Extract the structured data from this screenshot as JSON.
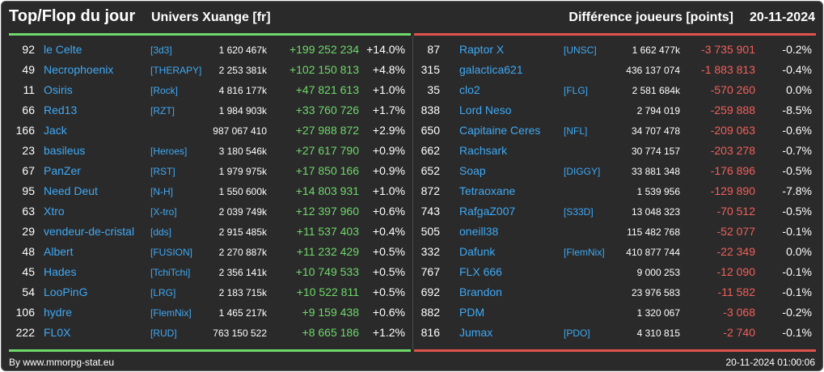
{
  "header": {
    "title": "Top/Flop du jour",
    "subtitle": "Univers Xuange [fr]",
    "metric": "Différence joueurs [points]",
    "date": "20-11-2024"
  },
  "colors": {
    "background": "#2a2a2a",
    "name": "#3fa9f5",
    "gain": "#6fd86a",
    "loss": "#f0605a"
  },
  "top": [
    {
      "rank": "92",
      "name": "le Celte",
      "alliance": "[3d3]",
      "points": "1 620 467k",
      "diff": "+199 252 234",
      "pct": "+14.0%"
    },
    {
      "rank": "49",
      "name": "Necrophoenix",
      "alliance": "[THERAPY]",
      "points": "2 253 381k",
      "diff": "+102 150 813",
      "pct": "+4.8%"
    },
    {
      "rank": "11",
      "name": "Osiris",
      "alliance": "[Rock]",
      "points": "4 816 177k",
      "diff": "+47 821 613",
      "pct": "+1.0%"
    },
    {
      "rank": "66",
      "name": "Red13",
      "alliance": "[RZT]",
      "points": "1 984 903k",
      "diff": "+33 760 726",
      "pct": "+1.7%"
    },
    {
      "rank": "166",
      "name": "Jack",
      "alliance": "",
      "points": "987 067 410",
      "diff": "+27 988 872",
      "pct": "+2.9%"
    },
    {
      "rank": "23",
      "name": "basileus",
      "alliance": "[Heroes]",
      "points": "3 180 546k",
      "diff": "+27 617 790",
      "pct": "+0.9%"
    },
    {
      "rank": "67",
      "name": "PanZer",
      "alliance": "[RST]",
      "points": "1 979 975k",
      "diff": "+17 850 166",
      "pct": "+0.9%"
    },
    {
      "rank": "95",
      "name": "Need Deut",
      "alliance": "[N-H]",
      "points": "1 550 600k",
      "diff": "+14 803 931",
      "pct": "+1.0%"
    },
    {
      "rank": "63",
      "name": "Xtro",
      "alliance": "[X-tro]",
      "points": "2 039 749k",
      "diff": "+12 397 960",
      "pct": "+0.6%"
    },
    {
      "rank": "29",
      "name": "vendeur-de-cristal",
      "alliance": "[dds]",
      "points": "2 915 485k",
      "diff": "+11 537 403",
      "pct": "+0.4%"
    },
    {
      "rank": "48",
      "name": "Albert",
      "alliance": "[FUSION]",
      "points": "2 270 887k",
      "diff": "+11 232 429",
      "pct": "+0.5%"
    },
    {
      "rank": "45",
      "name": "Hades",
      "alliance": "[TchiTchi]",
      "points": "2 356 141k",
      "diff": "+10 749 533",
      "pct": "+0.5%"
    },
    {
      "rank": "54",
      "name": "LooPinG",
      "alliance": "[LRG]",
      "points": "2 183 715k",
      "diff": "+10 522 811",
      "pct": "+0.5%"
    },
    {
      "rank": "106",
      "name": "hydre",
      "alliance": "[FlemNix]",
      "points": "1 465 217k",
      "diff": "+9 159 438",
      "pct": "+0.6%"
    },
    {
      "rank": "222",
      "name": "FL0X",
      "alliance": "[RUD]",
      "points": "763 150 522",
      "diff": "+8 665 186",
      "pct": "+1.2%"
    }
  ],
  "flop": [
    {
      "rank": "87",
      "name": "Raptor X",
      "alliance": "[UNSC]",
      "points": "1 662 477k",
      "diff": "-3 735 901",
      "pct": "-0.2%"
    },
    {
      "rank": "315",
      "name": "galactica621",
      "alliance": "",
      "points": "436 137 074",
      "diff": "-1 883 813",
      "pct": "-0.4%"
    },
    {
      "rank": "35",
      "name": "clo2",
      "alliance": "[FLG]",
      "points": "2 581 684k",
      "diff": "-570 260",
      "pct": "0.0%"
    },
    {
      "rank": "838",
      "name": "Lord Neso",
      "alliance": "",
      "points": "2 794 019",
      "diff": "-259 888",
      "pct": "-8.5%"
    },
    {
      "rank": "650",
      "name": "Capitaine Ceres",
      "alliance": "[NFL]",
      "points": "34 707 478",
      "diff": "-209 063",
      "pct": "-0.6%"
    },
    {
      "rank": "662",
      "name": "Rachsark",
      "alliance": "",
      "points": "30 774 157",
      "diff": "-203 278",
      "pct": "-0.7%"
    },
    {
      "rank": "652",
      "name": "Soap",
      "alliance": "[DIGGY]",
      "points": "33 881 348",
      "diff": "-176 896",
      "pct": "-0.5%"
    },
    {
      "rank": "872",
      "name": "Tetraoxane",
      "alliance": "",
      "points": "1 539 956",
      "diff": "-129 890",
      "pct": "-7.8%"
    },
    {
      "rank": "743",
      "name": "RafgaZ007",
      "alliance": "[S33D]",
      "points": "13 048 323",
      "diff": "-70 512",
      "pct": "-0.5%"
    },
    {
      "rank": "505",
      "name": "oneill38",
      "alliance": "",
      "points": "115 482 768",
      "diff": "-52 077",
      "pct": "-0.1%"
    },
    {
      "rank": "332",
      "name": "Dafunk",
      "alliance": "[FlemNix]",
      "points": "410 877 744",
      "diff": "-22 349",
      "pct": "0.0%"
    },
    {
      "rank": "767",
      "name": "FLX 666",
      "alliance": "",
      "points": "9 000 253",
      "diff": "-12 090",
      "pct": "-0.1%"
    },
    {
      "rank": "692",
      "name": "Brandon",
      "alliance": "",
      "points": "23 976 583",
      "diff": "-11 582",
      "pct": "-0.1%"
    },
    {
      "rank": "882",
      "name": "PDM",
      "alliance": "",
      "points": "1 320 067",
      "diff": "-3 068",
      "pct": "-0.2%"
    },
    {
      "rank": "816",
      "name": "Jumax",
      "alliance": "[PDO]",
      "points": "4 310 815",
      "diff": "-2 740",
      "pct": "-0.1%"
    }
  ],
  "footer": {
    "source": "By www.mmorpg-stat.eu",
    "timestamp": "20-11-2024 01:00:06"
  }
}
